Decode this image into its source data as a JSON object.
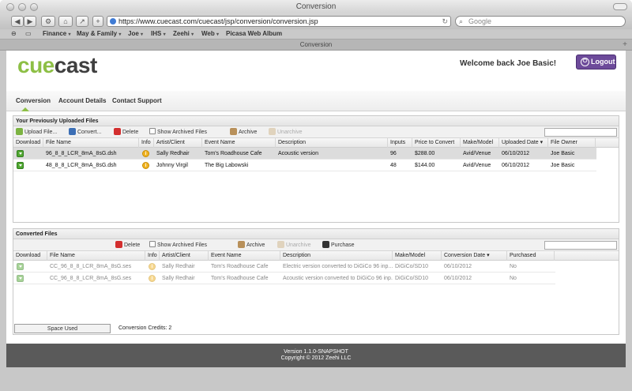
{
  "window": {
    "title": "Conversion"
  },
  "browser": {
    "url": "https://www.cuecast.com/cuecast/jsp/conversion/conversion.jsp",
    "search_placeholder": "Google",
    "bookmarks": [
      {
        "label": "Finance",
        "caret": "▾"
      },
      {
        "label": "May & Family",
        "caret": "▾"
      },
      {
        "label": "Joe",
        "caret": "▾"
      },
      {
        "label": "IHS",
        "caret": "▾"
      },
      {
        "label": "Zeehi",
        "caret": "▾"
      },
      {
        "label": "Web",
        "caret": "▾"
      },
      {
        "label": "Picasa Web Album",
        "caret": ""
      }
    ],
    "tab_title": "Conversion"
  },
  "header": {
    "logo_cue": "cue",
    "logo_cast": "cast",
    "welcome": "Welcome back Joe Basic!",
    "logout": "Logout"
  },
  "nav": {
    "tabs": [
      "Conversion",
      "Account Details",
      "Contact Support"
    ]
  },
  "uploaded": {
    "title": "Your Previously Uploaded Files",
    "toolbar": {
      "upload": "Upload File...",
      "convert": "Convert...",
      "delete": "Delete",
      "show_archived": "Show Archived Files",
      "archive": "Archive",
      "unarchive": "Unarchive"
    },
    "columns": [
      "Download",
      "File Name",
      "Info",
      "Artist/Client",
      "Event Name",
      "Description",
      "Inputs",
      "Price to Convert",
      "Make/Model",
      "Uploaded Date",
      "File Owner"
    ],
    "sort_indicator": "▾",
    "rows": [
      {
        "file": "96_8_8_LCR_8mA_8sG.dsh",
        "artist": "Sally Redhair",
        "event": "Tom's Roadhouse Cafe",
        "desc": "Acoustic version",
        "inputs": "96",
        "price": "$288.00",
        "model": "Avid/Venue",
        "date": "06/10/2012",
        "owner": "Joe Basic"
      },
      {
        "file": "48_8_8_LCR_8mA_8sG.dsh",
        "artist": "Johnny Virgil",
        "event": "The Big Labowski",
        "desc": "",
        "inputs": "48",
        "price": "$144.00",
        "model": "Avid/Venue",
        "date": "06/10/2012",
        "owner": "Joe Basic"
      }
    ]
  },
  "converted": {
    "title": "Converted Files",
    "toolbar": {
      "delete": "Delete",
      "show_archived": "Show Archived Files",
      "archive": "Archive",
      "unarchive": "Unarchive",
      "purchase": "Purchase"
    },
    "columns": [
      "Download",
      "File Name",
      "Info",
      "Artist/Client",
      "Event Name",
      "Description",
      "Make/Model",
      "Conversion Date",
      "Purchased"
    ],
    "sort_indicator": "▾",
    "rows": [
      {
        "file": "CC_96_8_8_LCR_8mA_8sG.ses",
        "artist": "Sally Redhair",
        "event": "Tom's Roadhouse Cafe",
        "desc": "Electric version converted to DiGiCo 96 inp...",
        "model": "DiGiCo/SD10",
        "date": "06/10/2012",
        "purchased": "No"
      },
      {
        "file": "CC_96_8_8_LCR_8mA_8sG.ses",
        "artist": "Sally Redhair",
        "event": "Tom's Roadhouse Cafe",
        "desc": "Acoustic version converted to DiGiCo 96 inp...",
        "model": "DiGiCo/SD10",
        "date": "06/10/2012",
        "purchased": "No"
      }
    ]
  },
  "status": {
    "space_used": "Space Used",
    "credits": "Conversion Credits: 2"
  },
  "footer": {
    "version": "Version 1.1.0-SNAPSHOT",
    "copyright": "Copyright © 2012 Zeehi LLC"
  }
}
